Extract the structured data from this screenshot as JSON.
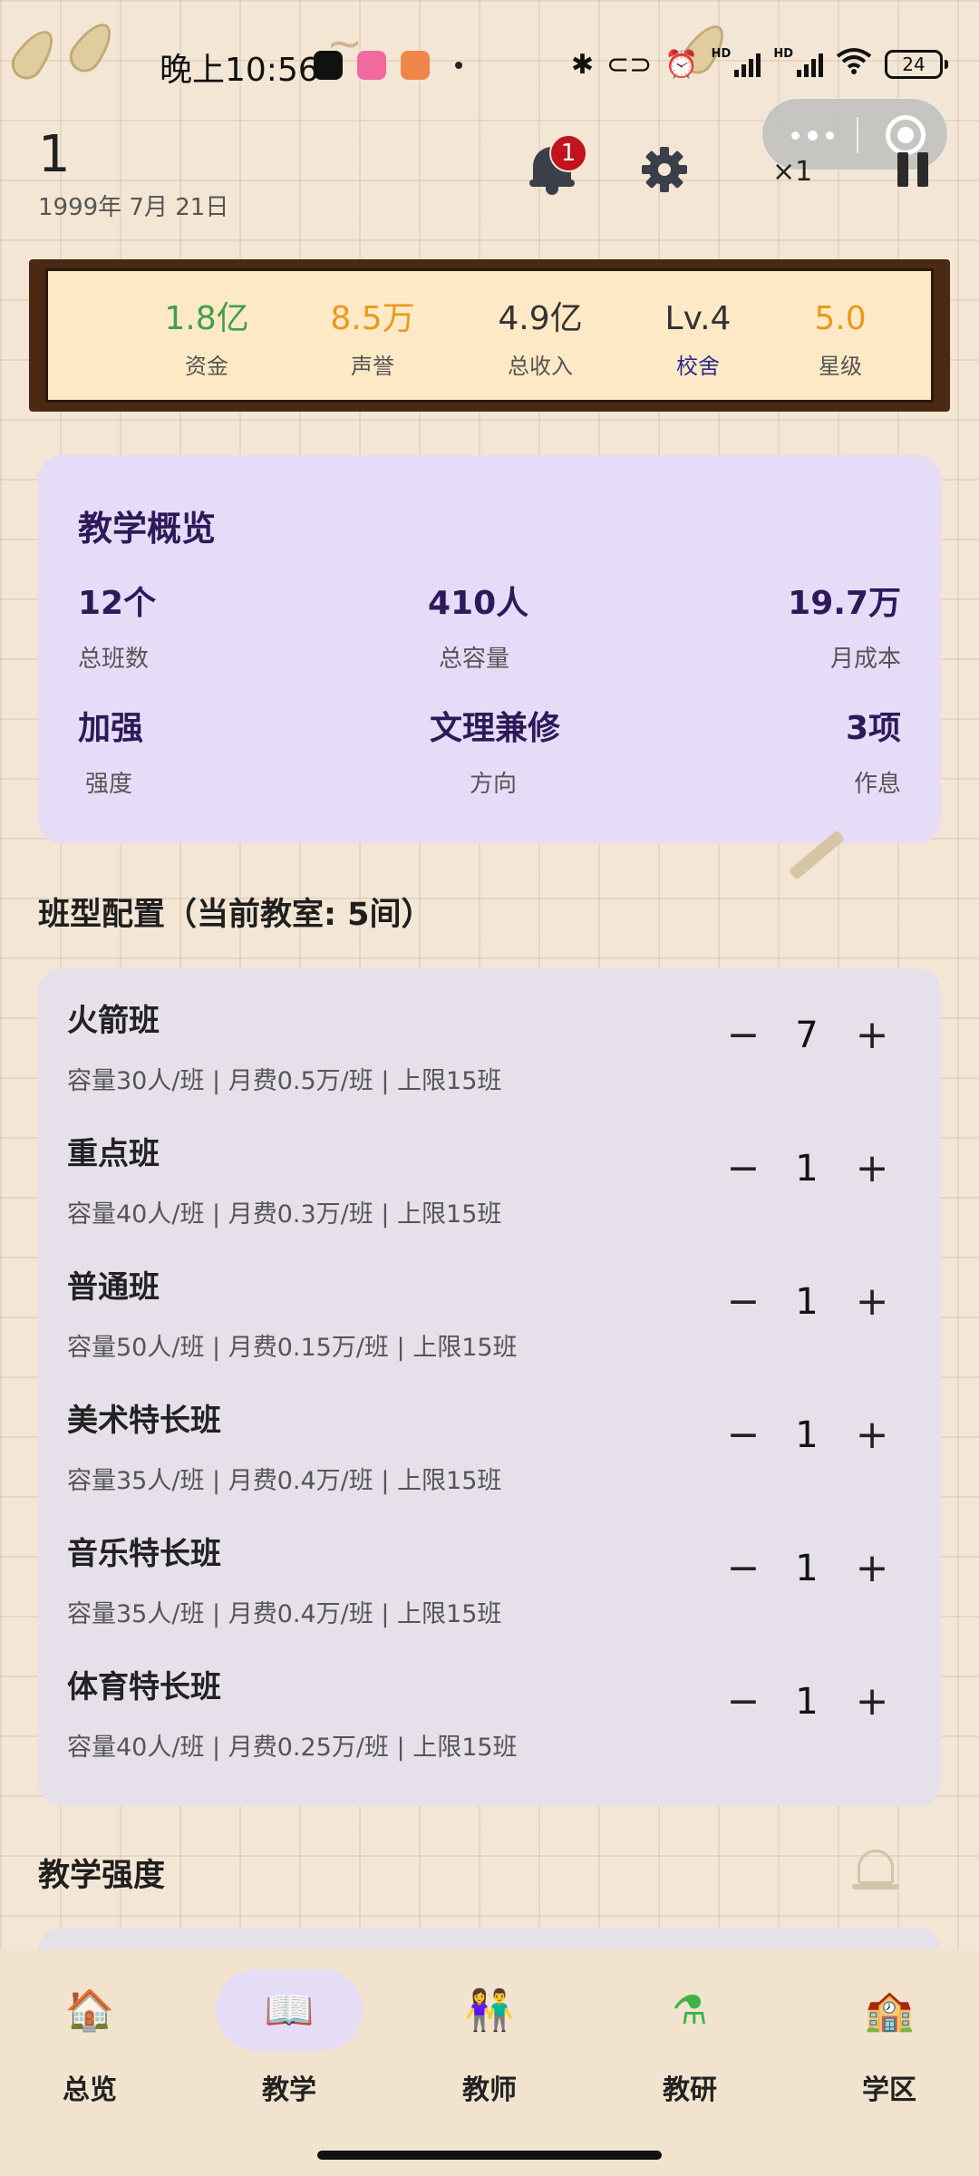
{
  "status_bar": {
    "time": "晚上10:56",
    "hd1": "HD",
    "hd2": "HD",
    "battery": "24"
  },
  "header": {
    "title": "1",
    "date": "1999年 7月 21日",
    "notification_count": "1",
    "speed": "×1"
  },
  "stats": [
    {
      "value": "1.8亿",
      "label": "资金",
      "value_color": "#3fa04a",
      "label_color": "#555555"
    },
    {
      "value": "8.5万",
      "label": "声誉",
      "value_color": "#e89a1a",
      "label_color": "#555555"
    },
    {
      "value": "4.9亿",
      "label": "总收入",
      "value_color": "#333333",
      "label_color": "#555555"
    },
    {
      "value": "Lv.4",
      "label": "校舍",
      "value_color": "#333333",
      "label_color": "#2c2a8a"
    },
    {
      "value": "5.0",
      "label": "星级",
      "value_color": "#e89a1a",
      "label_color": "#555555"
    }
  ],
  "overview": {
    "title": "教学概览",
    "items": [
      {
        "value": "12个",
        "label": "总班数"
      },
      {
        "value": "410人",
        "label": "总容量"
      },
      {
        "value": "19.7万",
        "label": "月成本"
      },
      {
        "value": "加强",
        "label": "强度"
      },
      {
        "value": "文理兼修",
        "label": "方向"
      },
      {
        "value": "3项",
        "label": "作息"
      }
    ]
  },
  "class_section_title": "班型配置（当前教室: 5间）",
  "classes": [
    {
      "name": "火箭班",
      "desc": "容量30人/班 | 月费0.5万/班 | 上限15班",
      "count": "7"
    },
    {
      "name": "重点班",
      "desc": "容量40人/班 | 月费0.3万/班 | 上限15班",
      "count": "1"
    },
    {
      "name": "普通班",
      "desc": "容量50人/班 | 月费0.15万/班 | 上限15班",
      "count": "1"
    },
    {
      "name": "美术特长班",
      "desc": "容量35人/班 | 月费0.4万/班 | 上限15班",
      "count": "1"
    },
    {
      "name": "音乐特长班",
      "desc": "容量35人/班 | 月费0.4万/班 | 上限15班",
      "count": "1"
    },
    {
      "name": "体育特长班",
      "desc": "容量40人/班 | 月费0.25万/班 | 上限15班",
      "count": "1"
    }
  ],
  "controls": {
    "minus": "−",
    "plus": "+"
  },
  "intensity_section_title": "教学强度",
  "nav": [
    {
      "label": "总览",
      "icon": "school-house-icon",
      "glyph": "🏠",
      "active": false
    },
    {
      "label": "教学",
      "icon": "open-book-icon",
      "glyph": "📖",
      "active": true
    },
    {
      "label": "教师",
      "icon": "teachers-icon",
      "glyph": "👫",
      "active": false
    },
    {
      "label": "教研",
      "icon": "flask-icon",
      "glyph": "⚗",
      "active": false
    },
    {
      "label": "学区",
      "icon": "campus-building-icon",
      "glyph": "🏫",
      "active": false
    }
  ]
}
